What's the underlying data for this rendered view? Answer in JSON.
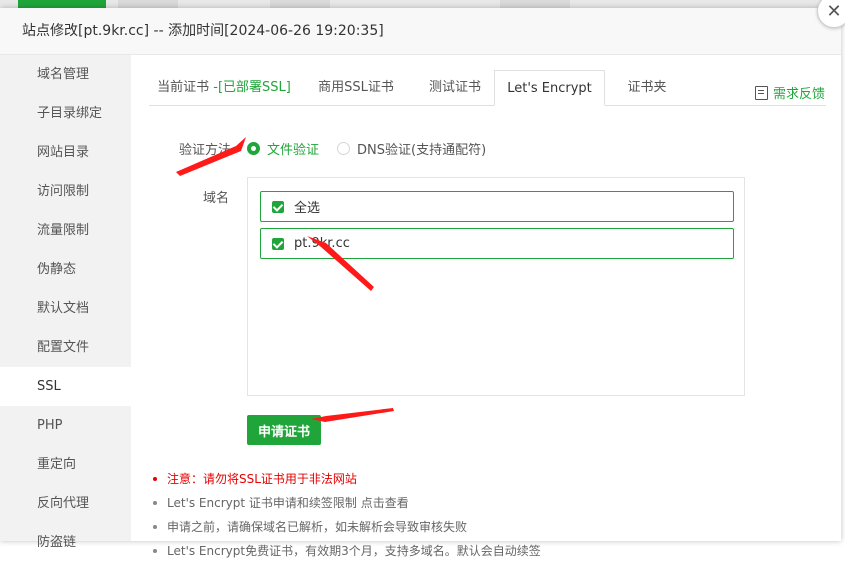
{
  "dialog": {
    "title": "站点修改[pt.9kr.cc] -- 添加时间[2024-06-26 19:20:35]"
  },
  "sidebar": {
    "items": [
      {
        "label": "域名管理"
      },
      {
        "label": "子目录绑定"
      },
      {
        "label": "网站目录"
      },
      {
        "label": "访问限制"
      },
      {
        "label": "流量限制"
      },
      {
        "label": "伪静态"
      },
      {
        "label": "默认文档"
      },
      {
        "label": "配置文件"
      },
      {
        "label": "SSL"
      },
      {
        "label": "PHP"
      },
      {
        "label": "重定向"
      },
      {
        "label": "反向代理"
      },
      {
        "label": "防盗链"
      }
    ],
    "active": "SSL"
  },
  "tabs": [
    {
      "label": "当前证书",
      "status": "-[已部署SSL]"
    },
    {
      "label": "商用SSL证书"
    },
    {
      "label": "测试证书"
    },
    {
      "label": "Let's Encrypt"
    },
    {
      "label": "证书夹"
    }
  ],
  "active_tab": "Let's Encrypt",
  "feedback": {
    "label": "需求反馈"
  },
  "verify": {
    "label": "验证方法",
    "options": [
      {
        "label": "文件验证",
        "selected": true
      },
      {
        "label": "DNS验证(支持通配符)",
        "selected": false
      }
    ]
  },
  "domains": {
    "label": "域名",
    "select_all": "全选",
    "items": [
      {
        "label": "pt.9kr.cc",
        "checked": true
      }
    ]
  },
  "apply_button": {
    "label": "申请证书"
  },
  "notes": [
    {
      "text": "注意：请勿将SSL证书用于非法网站",
      "warn": true
    },
    {
      "text": "Let's Encrypt 证书申请和续签限制 点击查看",
      "warn": false
    },
    {
      "text": "申请之前，请确保域名已解析，如未解析会导致审核失败",
      "warn": false
    },
    {
      "text": "Let's Encrypt免费证书，有效期3个月，支持多域名。默认会自动续签",
      "warn": false
    }
  ],
  "colors": {
    "accent": "#20a53a",
    "warning": "#e60000",
    "annotation_arrow": "#ff1a1a"
  }
}
